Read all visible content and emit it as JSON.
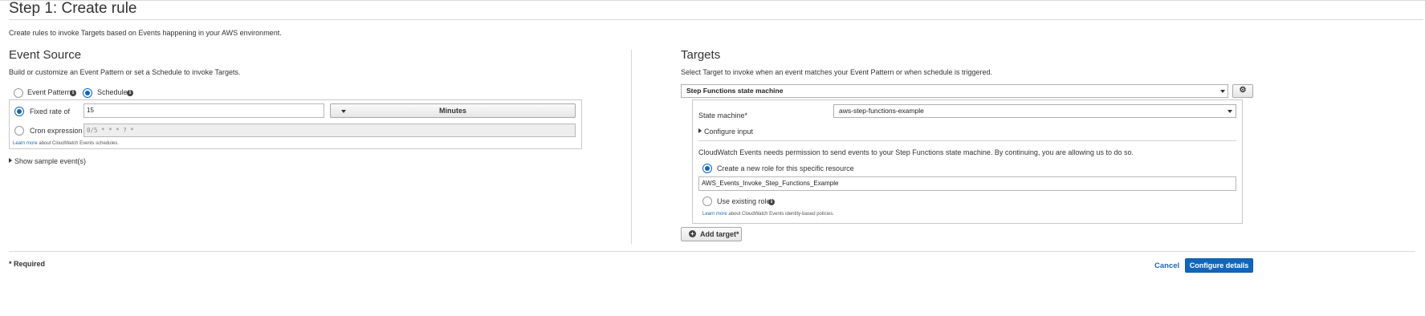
{
  "header": {
    "title": "Step 1: Create rule",
    "description": "Create rules to invoke Targets based on Events happening in your AWS environment."
  },
  "event_source": {
    "title": "Event Source",
    "description": "Build or customize an Event Pattern or set a Schedule to invoke Targets.",
    "options": {
      "event_pattern": "Event Pattern",
      "schedule": "Schedule",
      "selected": "Schedule"
    },
    "schedule": {
      "fixed_rate_label": "Fixed rate of",
      "fixed_rate_value": "15",
      "unit": "Minutes",
      "cron_label": "Cron expression",
      "cron_placeholder": "0/5 * * * ? *",
      "selected": "Fixed rate of",
      "learn_more_link": "Learn more",
      "learn_more_text": "about CloudWatch Events schedules."
    },
    "show_sample": "Show sample event(s)"
  },
  "targets": {
    "title": "Targets",
    "description": "Select Target to invoke when an event matches your Event Pattern or when schedule is triggered.",
    "target_type": "Step Functions state machine",
    "state_machine_label": "State machine*",
    "state_machine_value": "aws-step-functions-example",
    "configure_input": "Configure input",
    "permission_text": "CloudWatch Events needs permission to send events to your Step Functions state machine. By continuing, you are allowing us to do so.",
    "create_role_label": "Create a new role for this specific resource",
    "role_name": "AWS_Events_Invoke_Step_Functions_Example",
    "use_existing_label": "Use existing role",
    "selected_role_option": "Create a new role for this specific resource",
    "learn_more_link": "Learn more",
    "learn_more_text": "about CloudWatch Events identity-based policies.",
    "add_target": "Add target*"
  },
  "footer": {
    "required_note": "* Required",
    "cancel": "Cancel",
    "configure_details": "Configure details"
  },
  "colors": {
    "primary": "#1166bb",
    "link": "#1c68b3"
  },
  "icons": [
    "info-icon",
    "caret-down-icon",
    "caret-right-icon",
    "gear-icon",
    "plus-circle-icon"
  ]
}
